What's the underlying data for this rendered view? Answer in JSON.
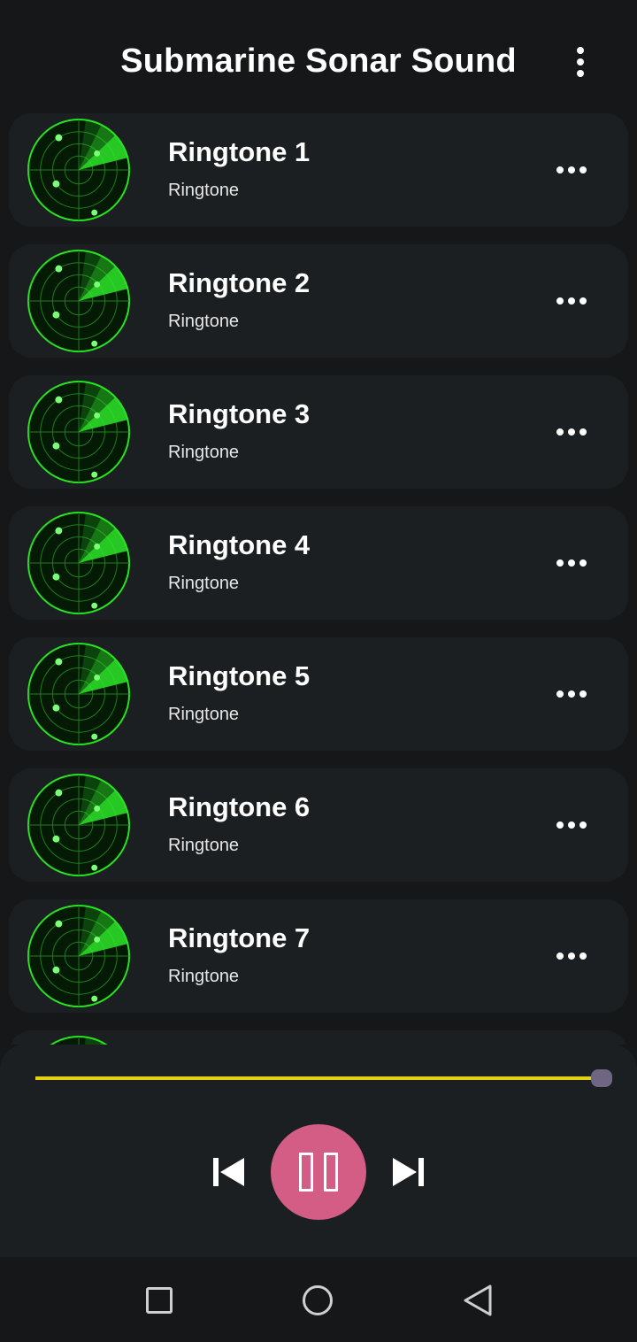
{
  "header": {
    "title": "Submarine Sonar Sound",
    "menu_icon": "more-vertical-icon"
  },
  "ringtones": [
    {
      "name": "Ringtone 1",
      "subtitle": "Ringtone"
    },
    {
      "name": "Ringtone 2",
      "subtitle": "Ringtone"
    },
    {
      "name": "Ringtone 3",
      "subtitle": "Ringtone"
    },
    {
      "name": "Ringtone 4",
      "subtitle": "Ringtone"
    },
    {
      "name": "Ringtone 5",
      "subtitle": "Ringtone"
    },
    {
      "name": "Ringtone 6",
      "subtitle": "Ringtone"
    },
    {
      "name": "Ringtone 7",
      "subtitle": "Ringtone"
    }
  ],
  "icons": {
    "item_thumbnail": "radar-icon",
    "item_menu": "more-horizontal-icon",
    "prev": "skip-previous-icon",
    "play_pause": "pause-icon",
    "next": "skip-next-icon",
    "nav_recent": "square-icon",
    "nav_home": "circle-icon",
    "nav_back": "triangle-back-icon"
  },
  "player": {
    "progress": 1.0,
    "state": "playing"
  },
  "colors": {
    "background": "#151719",
    "card": "#1c1f21",
    "seek_bar": "#e3d111",
    "seek_thumb": "#6e6682",
    "play_button": "#d45d85",
    "radar_green": "#22e01e"
  }
}
